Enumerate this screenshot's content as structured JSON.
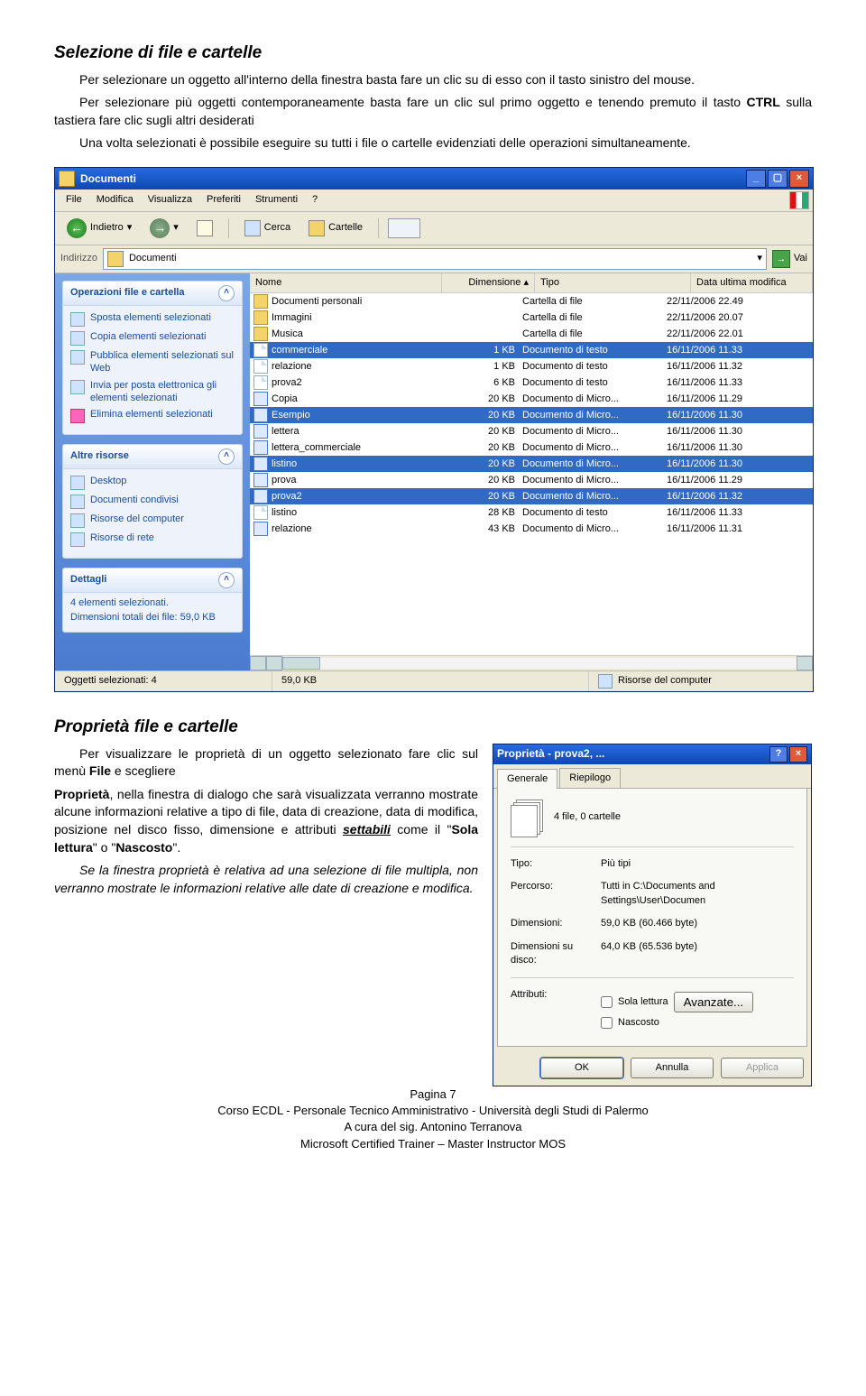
{
  "doc": {
    "h1": "Selezione di file e cartelle",
    "p1": "Per selezionare un oggetto all'interno della finestra basta fare un clic su di esso con il tasto sinistro del mouse.",
    "p2a": "Per selezionare più oggetti contemporaneamente basta fare un clic sul primo oggetto e tenendo premuto il tasto ",
    "p2b": "CTRL",
    "p2c": " sulla tastiera fare clic sugli altri desiderati",
    "p3": "Una volta selezionati è possibile eseguire su tutti i file o cartelle evidenziati delle operazioni simultaneamente.",
    "h2": "Proprietà file e cartelle",
    "p4a": "Per visualizzare le proprietà di un oggetto selezionato fare clic sul menù ",
    "p4b": "File",
    "p4c": " e scegliere ",
    "p5a": "Proprietà",
    "p5b": ", nella finestra di dialogo che sarà visualizzata verranno mostrate alcune informazioni relative a tipo di file, data di creazione, data di modifica, posizione nel disco fisso, dimensione e attributi ",
    "p5c": "settabili",
    "p5d": " come il \"",
    "p5e": "Sola lettura",
    "p5f": "\" o \"",
    "p5g": "Nascosto",
    "p5h": "\".",
    "p6": "Se la finestra proprietà è relativa ad una selezione di file multipla, non verranno mostrate le informazioni relative alle date di creazione e modifica."
  },
  "win": {
    "title": "Documenti",
    "menus": [
      "File",
      "Modifica",
      "Visualizza",
      "Preferiti",
      "Strumenti",
      "?"
    ],
    "back": "Indietro",
    "search": "Cerca",
    "folders": "Cartelle",
    "addrlabel": "Indirizzo",
    "addrval": "Documenti",
    "go": "Vai",
    "cols": {
      "name": "Nome",
      "dim": "Dimensione",
      "type": "Tipo",
      "date": "Data ultima modifica"
    },
    "panels": {
      "ops": {
        "title": "Operazioni file e cartella",
        "items": [
          "Sposta elementi selezionati",
          "Copia elementi selezionati",
          "Pubblica elementi selezionati sul Web",
          "Invia per posta elettronica gli elementi selezionati",
          "Elimina elementi selezionati"
        ]
      },
      "other": {
        "title": "Altre risorse",
        "items": [
          "Desktop",
          "Documenti condivisi",
          "Risorse del computer",
          "Risorse di rete"
        ]
      },
      "details": {
        "title": "Dettagli",
        "line1": "4 elementi selezionati.",
        "line2": "Dimensioni totali dei file: 59,0 KB"
      }
    },
    "files": [
      {
        "ic": "fld",
        "name": "Documenti personali",
        "dim": "",
        "type": "Cartella di file",
        "date": "22/11/2006 22.49",
        "sel": false
      },
      {
        "ic": "fld",
        "name": "Immagini",
        "dim": "",
        "type": "Cartella di file",
        "date": "22/11/2006 20.07",
        "sel": false
      },
      {
        "ic": "fld",
        "name": "Musica",
        "dim": "",
        "type": "Cartella di file",
        "date": "22/11/2006 22.01",
        "sel": false
      },
      {
        "ic": "txt",
        "name": "commerciale",
        "dim": "1 KB",
        "type": "Documento di testo",
        "date": "16/11/2006 11.33",
        "sel": true
      },
      {
        "ic": "txt",
        "name": "relazione",
        "dim": "1 KB",
        "type": "Documento di testo",
        "date": "16/11/2006 11.32",
        "sel": false
      },
      {
        "ic": "txt",
        "name": "prova2",
        "dim": "6 KB",
        "type": "Documento di testo",
        "date": "16/11/2006 11.33",
        "sel": false
      },
      {
        "ic": "doc",
        "name": "Copia",
        "dim": "20 KB",
        "type": "Documento di Micro...",
        "date": "16/11/2006 11.29",
        "sel": false
      },
      {
        "ic": "doc",
        "name": "Esempio",
        "dim": "20 KB",
        "type": "Documento di Micro...",
        "date": "16/11/2006 11.30",
        "sel": true
      },
      {
        "ic": "doc",
        "name": "lettera",
        "dim": "20 KB",
        "type": "Documento di Micro...",
        "date": "16/11/2006 11.30",
        "sel": false
      },
      {
        "ic": "doc",
        "name": "lettera_commerciale",
        "dim": "20 KB",
        "type": "Documento di Micro...",
        "date": "16/11/2006 11.30",
        "sel": false
      },
      {
        "ic": "doc",
        "name": "listino",
        "dim": "20 KB",
        "type": "Documento di Micro...",
        "date": "16/11/2006 11.30",
        "sel": true
      },
      {
        "ic": "doc",
        "name": "prova",
        "dim": "20 KB",
        "type": "Documento di Micro...",
        "date": "16/11/2006 11.29",
        "sel": false
      },
      {
        "ic": "doc",
        "name": "prova2",
        "dim": "20 KB",
        "type": "Documento di Micro...",
        "date": "16/11/2006 11.32",
        "sel": true
      },
      {
        "ic": "txt",
        "name": "listino",
        "dim": "28 KB",
        "type": "Documento di testo",
        "date": "16/11/2006 11.33",
        "sel": false
      },
      {
        "ic": "doc",
        "name": "relazione",
        "dim": "43 KB",
        "type": "Documento di Micro...",
        "date": "16/11/2006 11.31",
        "sel": false
      }
    ],
    "status": {
      "left": "Oggetti selezionati: 4",
      "mid": "59,0 KB",
      "right": "Risorse del computer"
    }
  },
  "props": {
    "title": "Proprietà - prova2, ...",
    "tabs": [
      "Generale",
      "Riepilogo"
    ],
    "summary": "4 file, 0 cartelle",
    "rows": {
      "tipo_l": "Tipo:",
      "tipo_v": "Più tipi",
      "perc_l": "Percorso:",
      "perc_v": "Tutti in C:\\Documents and Settings\\User\\Documen",
      "dim_l": "Dimensioni:",
      "dim_v": "59,0 KB (60.466 byte)",
      "disk_l": "Dimensioni su disco:",
      "disk_v": "64,0 KB (65.536 byte)",
      "attr_l": "Attributi:",
      "ro": "Sola lettura",
      "hid": "Nascosto",
      "adv": "Avanzate..."
    },
    "btns": {
      "ok": "OK",
      "cancel": "Annulla",
      "apply": "Applica"
    }
  },
  "footer": {
    "l1": "Pagina 7",
    "l2": "Corso ECDL - Personale Tecnico Amministrativo - Università degli Studi di Palermo",
    "l3": "A cura del sig. Antonino Terranova",
    "l4": "Microsoft Certified Trainer – Master Instructor MOS"
  }
}
